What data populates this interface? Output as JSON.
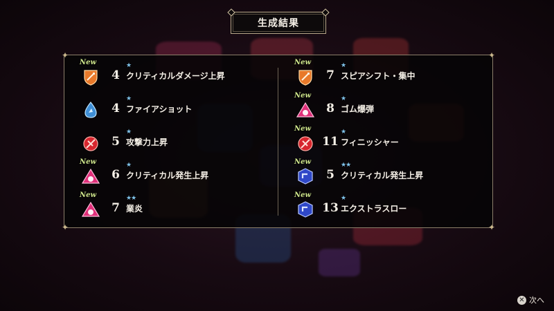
{
  "title": "生成結果",
  "left_items": [
    {
      "new": "New",
      "icon": "orange-shield-sword-icon",
      "num": "4",
      "stars": "★",
      "name": "クリティカルダメージ上昇"
    },
    {
      "new": "",
      "icon": "blue-droplet-gem-icon",
      "num": "4",
      "stars": "★",
      "name": "ファイアショット"
    },
    {
      "new": "",
      "icon": "red-sword-orb-icon",
      "num": "5",
      "stars": "★",
      "name": "攻撃力上昇"
    },
    {
      "new": "New",
      "icon": "pink-triangle-gem-icon",
      "num": "6",
      "stars": "★",
      "name": "クリティカル発生上昇"
    },
    {
      "new": "New",
      "icon": "pink-triangle-gem-icon",
      "num": "7",
      "stars": "★★",
      "name": "業炎"
    }
  ],
  "right_items": [
    {
      "new": "New",
      "icon": "orange-shield-sword-icon",
      "num": "7",
      "stars": "★",
      "name": "スピアシフト・集中"
    },
    {
      "new": "New",
      "icon": "pink-triangle-gem-icon",
      "num": "8",
      "stars": "★",
      "name": "ゴム爆弾"
    },
    {
      "new": "New",
      "icon": "red-sword-orb-icon",
      "num": "11",
      "stars": "★",
      "name": "フィニッシャー"
    },
    {
      "new": "New",
      "icon": "blue-hexagon-gem-icon",
      "num": "5",
      "stars": "★★",
      "name": "クリティカル発生上昇"
    },
    {
      "new": "New",
      "icon": "blue-hexagon-gem-icon",
      "num": "13",
      "stars": "★",
      "name": "エクストラスロー"
    }
  ],
  "footer": {
    "button_glyph": "✕",
    "next_label": "次へ"
  },
  "colors": {
    "panel_border": "#8c7f6a",
    "star": "#7fc3ea",
    "new_tag": "#cfe68c"
  }
}
